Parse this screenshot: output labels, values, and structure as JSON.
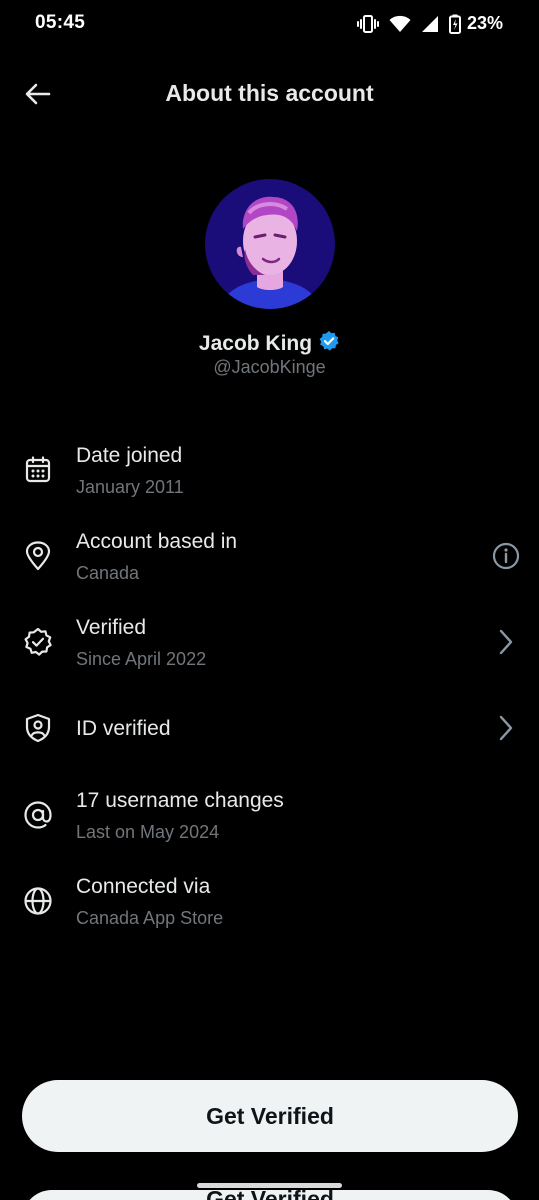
{
  "status_bar": {
    "time": "05:45",
    "battery": "23%",
    "icons": [
      "vibrate-icon",
      "wifi-icon",
      "signal-icon",
      "battery-charging-icon"
    ]
  },
  "header": {
    "title": "About this account",
    "back_icon": "arrow-left-icon"
  },
  "profile": {
    "name": "Jacob King",
    "handle": "@JacobKinge",
    "verified_badge_color": "#1d9bf0"
  },
  "rows": [
    {
      "icon": "calendar-icon",
      "title": "Date joined",
      "subtitle": "January 2011"
    },
    {
      "icon": "location-pin-icon",
      "title": "Account based in",
      "subtitle": "Canada",
      "trailing": "info-icon"
    },
    {
      "icon": "verified-badge-icon",
      "title": "Verified",
      "subtitle": "Since April 2022",
      "trailing": "chevron-right-icon"
    },
    {
      "icon": "id-shield-icon",
      "title": "ID verified",
      "trailing": "chevron-right-icon"
    },
    {
      "icon": "at-sign-icon",
      "title": "17 username changes",
      "subtitle": "Last on May 2024"
    },
    {
      "icon": "globe-icon",
      "title": "Connected via",
      "subtitle": "Canada App Store"
    }
  ],
  "cta": {
    "label": "Get Verified",
    "background": "#eff3f4",
    "text_color": "#0f1419"
  },
  "colors": {
    "background": "#000000",
    "primary_text": "#e7e9ea",
    "secondary_text": "#71767b"
  }
}
